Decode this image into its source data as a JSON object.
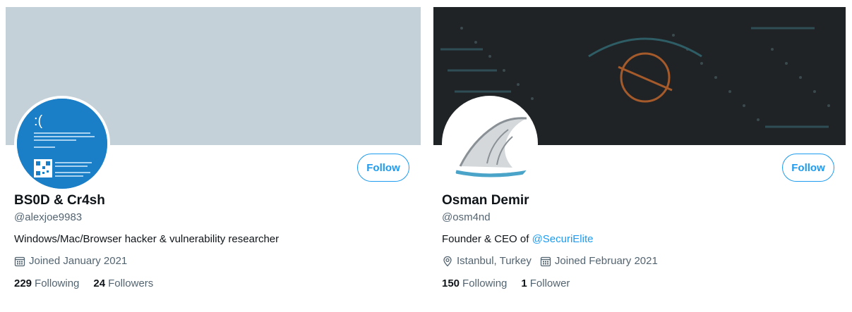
{
  "profiles": [
    {
      "follow_label": "Follow",
      "display_name": "BS0D & Cr4sh",
      "handle": "@alexjoe9983",
      "bio": "Windows/Mac/Browser hacker & vulnerability researcher",
      "joined": "Joined January 2021",
      "following_count": "229",
      "following_label": "Following",
      "followers_count": "24",
      "followers_label": "Followers",
      "avatar_icon": "bsod-screen-avatar",
      "avatar_text": ":(",
      "banner_color": "#c5d1d9"
    },
    {
      "follow_label": "Follow",
      "display_name": "Osman Demir",
      "handle": "@osm4nd",
      "bio_prefix": "Founder & CEO of ",
      "bio_mention": "@SecuriElite",
      "location": "Istanbul, Turkey",
      "joined": "Joined February 2021",
      "following_count": "150",
      "following_label": "Following",
      "followers_count": "1",
      "followers_label": "Follower",
      "avatar_icon": "shark-fin-avatar",
      "banner_color": "#1f2326"
    }
  ],
  "colors": {
    "accent": "#1d9bf0",
    "secondary_text": "#536471",
    "primary_text": "#0f1419"
  }
}
